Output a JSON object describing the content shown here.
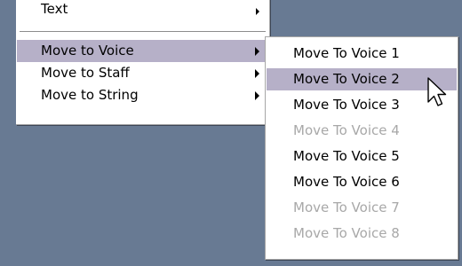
{
  "main_menu": {
    "items": [
      {
        "label": "Text"
      },
      {
        "label": "Move to Voice"
      },
      {
        "label": "Move to Staff"
      },
      {
        "label": "Move to String"
      }
    ]
  },
  "submenu": {
    "items": [
      {
        "label": "Move To Voice 1",
        "enabled": true
      },
      {
        "label": "Move To Voice 2",
        "enabled": true,
        "highlighted": true
      },
      {
        "label": "Move To Voice 3",
        "enabled": true
      },
      {
        "label": "Move To Voice 4",
        "enabled": false
      },
      {
        "label": "Move To Voice 5",
        "enabled": true
      },
      {
        "label": "Move To Voice 6",
        "enabled": true
      },
      {
        "label": "Move To Voice 7",
        "enabled": false
      },
      {
        "label": "Move To Voice 8",
        "enabled": false
      }
    ]
  },
  "colors": {
    "desktop_background": "#687a93",
    "menu_background": "#ffffff",
    "highlight": "#b6b0c8",
    "disabled_text": "#a8a8a8"
  },
  "icons": {
    "submenu_arrow": "right-triangle",
    "pointer": "arrow-cursor"
  }
}
